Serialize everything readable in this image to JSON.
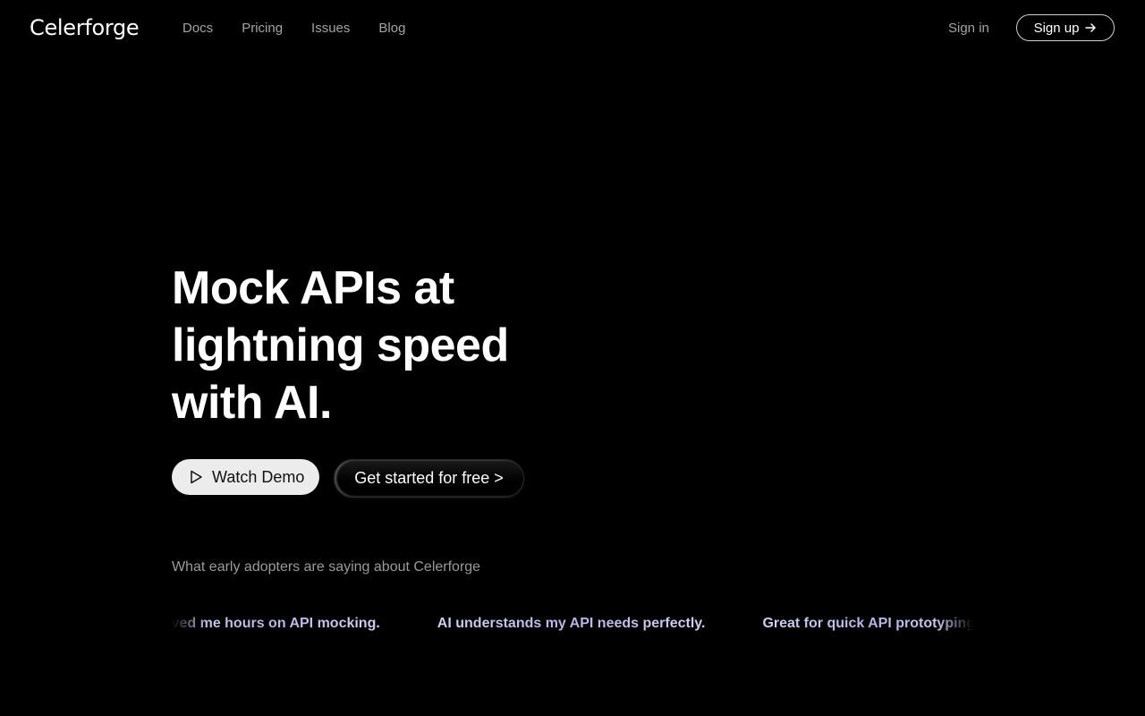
{
  "brand": {
    "name": "Celerforge"
  },
  "nav": {
    "links": [
      {
        "label": "Docs"
      },
      {
        "label": "Pricing"
      },
      {
        "label": "Issues"
      },
      {
        "label": "Blog"
      }
    ],
    "sign_in": "Sign in",
    "sign_up": "Sign up",
    "sign_up_icon": "arrow-right-icon"
  },
  "hero": {
    "title_lines": [
      "Mock APIs at",
      "lightning speed",
      "with AI."
    ],
    "watch_demo": "Watch Demo",
    "watch_demo_icon": "play-icon",
    "get_started": "Get started for free >"
  },
  "testimonials": {
    "heading": "What early adopters are saying about Celerforge",
    "quotes": [
      "Saved me hours on API mocking.",
      "AI understands my API needs perfectly.",
      "Great for quick API prototyping."
    ]
  },
  "colors": {
    "background": "#000000",
    "text": "#ffffff",
    "muted": "#a3a3a3",
    "quote_gradient": "#b8b4e6"
  }
}
